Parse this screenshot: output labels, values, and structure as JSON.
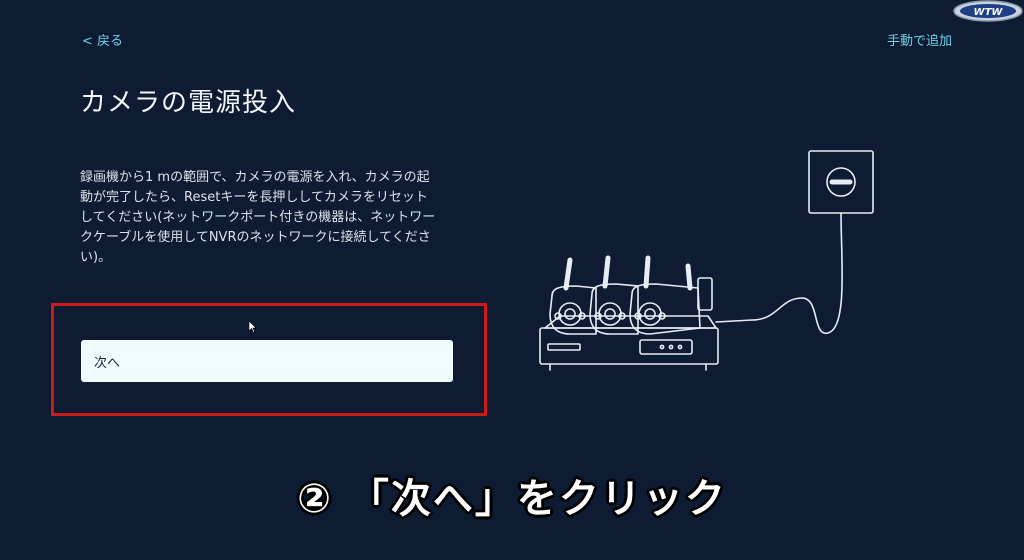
{
  "header": {
    "back_label": "< 戻る",
    "manual_add_label": "手動で追加",
    "logo_text": "WTW"
  },
  "main": {
    "title": "カメラの電源投入",
    "description": "録画機から1 mの範囲で、カメラの電源を入れ、カメラの起動が完了したら、Resetキーを長押ししてカメラをリセットしてください(ネットワークポート付きの機器は、ネットワークケーブルを使用してNVRのネットワークに接続してください)。",
    "next_button_label": "次へ"
  },
  "overlay": {
    "caption": "② 「次へ」をクリック",
    "highlight_color": "#d11a1a"
  },
  "colors": {
    "background": "#0d1b33",
    "accent": "#6fd3e8",
    "button_bg": "#eefcff"
  }
}
